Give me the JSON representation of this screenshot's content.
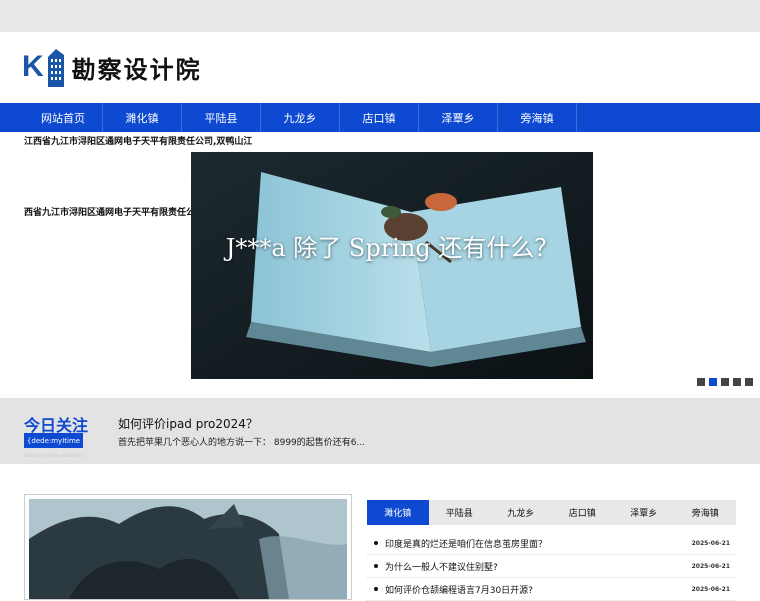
{
  "site": {
    "logo_letter": "K",
    "name": "勘察设计院"
  },
  "nav": {
    "items": [
      "网站首页",
      "濉化镇",
      "平陆县",
      "九龙乡",
      "店口镇",
      "泽覃乡",
      "旁海镇"
    ]
  },
  "side_texts": [
    "江西省九江市浔阳区通网电子天平有限责任公司,双鸭山江",
    "西省九江市浔阳区通网电子天平有限责任公司"
  ],
  "banner": {
    "caption": "J***a 除了 Spring 还有什么？",
    "dots": 5,
    "active_dot": 1
  },
  "today": {
    "title": "今日关注",
    "tag": "{dede:myItime",
    "tiny": "dede:myItime.addtime/}",
    "headline": "如何评价ipad pro2024？",
    "summary": "首先把苹果几个恶心人的地方说一下： 8999的起售价还有6..."
  },
  "tabs": {
    "items": [
      "濉化镇",
      "平陆县",
      "九龙乡",
      "店口镇",
      "泽覃乡",
      "旁海镇"
    ],
    "active": 0
  },
  "news": [
    {
      "title": "印度是真的烂还是咱们在信息茧房里面？",
      "date": "2025-06-21"
    },
    {
      "title": "为什么一般人不建议住别墅?",
      "date": "2025-06-21"
    },
    {
      "title": "如何评价仓颉编程语言7月30日开源?",
      "date": "2025-06-21"
    }
  ],
  "colors": {
    "accent": "#0d49d1",
    "topbar": "#e8e8e8",
    "band": "#e3e3e3"
  }
}
